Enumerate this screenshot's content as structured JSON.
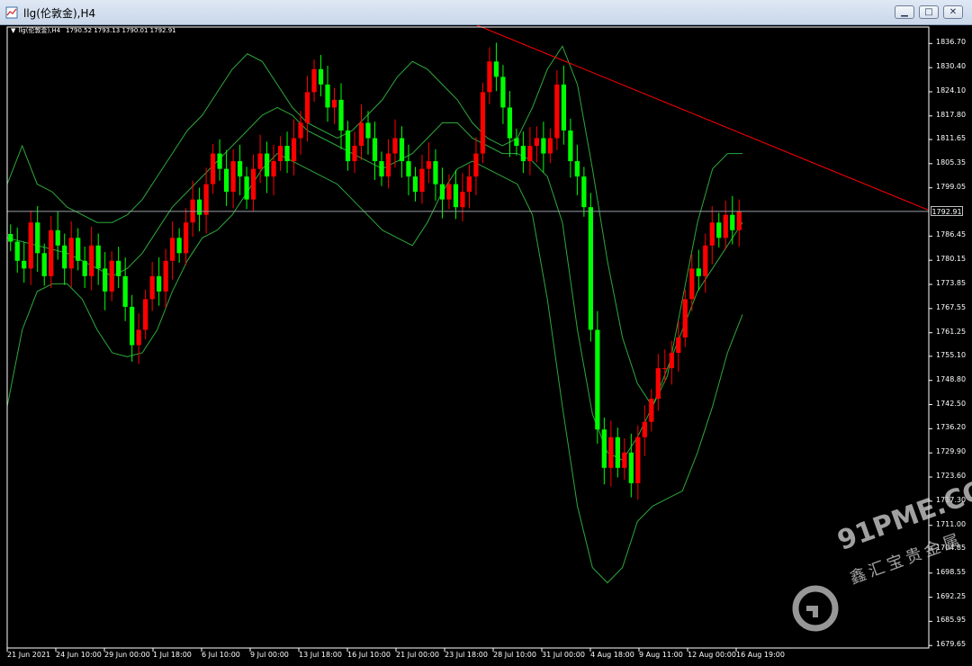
{
  "window": {
    "title": "llg(伦敦金),H4",
    "controls": {
      "minimize": "▁",
      "maximize": "□",
      "close": "✕"
    }
  },
  "legend": {
    "symbol": "llg(伦敦金),H4",
    "ohlc": "1790.52 1793.13 1790.01 1792.91"
  },
  "watermark": {
    "main": "91PME.COM",
    "sub": "鑫汇宝贵金属"
  },
  "colors": {
    "up": "#ff0000",
    "down": "#00ff00",
    "band": "#2ea83a",
    "trendline": "#ff0000",
    "priceLine": "#9aa0a8",
    "axis": "#ffffff",
    "background": "#000000"
  },
  "chart_data": {
    "type": "candlestick",
    "title": "",
    "ylim": [
      1679.0,
      1841.0
    ],
    "current_price": "1792.91",
    "yticks": [
      "1836.70",
      "1830.40",
      "1824.10",
      "1817.80",
      "1811.65",
      "1805.35",
      "1799.05",
      "1792.91",
      "1786.45",
      "1780.15",
      "1773.85",
      "1767.55",
      "1761.25",
      "1755.10",
      "1748.80",
      "1742.50",
      "1736.20",
      "1729.90",
      "1723.60",
      "1717.30",
      "1711.00",
      "1704.85",
      "1698.55",
      "1692.25",
      "1685.95",
      "1679.65"
    ],
    "xticks": [
      "21 Jun 2021",
      "24 Jun 10:00",
      "29 Jun 00:00",
      "1 Jul 18:00",
      "6 Jul 10:00",
      "9 Jul 00:00",
      "13 Jul 18:00",
      "16 Jul 10:00",
      "21 Jul 00:00",
      "23 Jul 18:00",
      "28 Jul 10:00",
      "31 Jul 00:00",
      "4 Aug 18:00",
      "9 Aug 11:00",
      "12 Aug 00:00",
      "16 Aug 19:00"
    ],
    "closes": [
      1785,
      1780,
      1778,
      1790,
      1782,
      1776,
      1788,
      1784,
      1778,
      1786,
      1780,
      1776,
      1784,
      1778,
      1772,
      1780,
      1776,
      1768,
      1758,
      1762,
      1770,
      1776,
      1772,
      1780,
      1786,
      1782,
      1790,
      1796,
      1792,
      1800,
      1808,
      1804,
      1798,
      1806,
      1802,
      1796,
      1804,
      1808,
      1802,
      1806,
      1810,
      1806,
      1812,
      1816,
      1824,
      1830,
      1826,
      1820,
      1822,
      1814,
      1806,
      1810,
      1816,
      1812,
      1806,
      1802,
      1808,
      1812,
      1806,
      1802,
      1798,
      1804,
      1806,
      1800,
      1796,
      1800,
      1794,
      1798,
      1802,
      1808,
      1824,
      1832,
      1828,
      1820,
      1812,
      1810,
      1806,
      1810,
      1812,
      1808,
      1812,
      1826,
      1814,
      1806,
      1802,
      1794,
      1762,
      1736,
      1726,
      1734,
      1726,
      1730,
      1722,
      1734,
      1738,
      1744,
      1752,
      1752,
      1756,
      1760,
      1770,
      1778,
      1776,
      1784,
      1790,
      1786,
      1792,
      1788,
      1792.91
    ],
    "bands": {
      "upper": [
        1800,
        1810,
        1800,
        1798,
        1794,
        1792,
        1790,
        1790,
        1792,
        1796,
        1802,
        1808,
        1814,
        1818,
        1824,
        1830,
        1834,
        1832,
        1826,
        1820,
        1816,
        1814,
        1812,
        1814,
        1818,
        1822,
        1828,
        1832,
        1830,
        1826,
        1822,
        1816,
        1812,
        1810,
        1812,
        1820,
        1830,
        1836,
        1826,
        1804,
        1780,
        1760,
        1748,
        1742,
        1750,
        1770,
        1790,
        1804,
        1808,
        1808
      ],
      "middle": [
        1786,
        1785,
        1784,
        1783,
        1782,
        1780,
        1778,
        1776,
        1778,
        1782,
        1788,
        1794,
        1798,
        1802,
        1806,
        1810,
        1814,
        1818,
        1820,
        1818,
        1814,
        1812,
        1810,
        1808,
        1806,
        1804,
        1806,
        1808,
        1812,
        1816,
        1816,
        1812,
        1810,
        1808,
        1808,
        1806,
        1802,
        1790,
        1762,
        1740,
        1730,
        1728,
        1734,
        1742,
        1752,
        1762,
        1772,
        1778,
        1784,
        1790
      ],
      "lower": [
        1742,
        1762,
        1772,
        1774,
        1774,
        1770,
        1762,
        1756,
        1755,
        1756,
        1762,
        1772,
        1780,
        1786,
        1788,
        1792,
        1798,
        1804,
        1808,
        1806,
        1804,
        1802,
        1800,
        1796,
        1792,
        1788,
        1786,
        1784,
        1790,
        1798,
        1804,
        1806,
        1804,
        1802,
        1800,
        1792,
        1770,
        1742,
        1716,
        1700,
        1696,
        1700,
        1712,
        1716,
        1718,
        1720,
        1730,
        1742,
        1756,
        1766
      ]
    }
  }
}
